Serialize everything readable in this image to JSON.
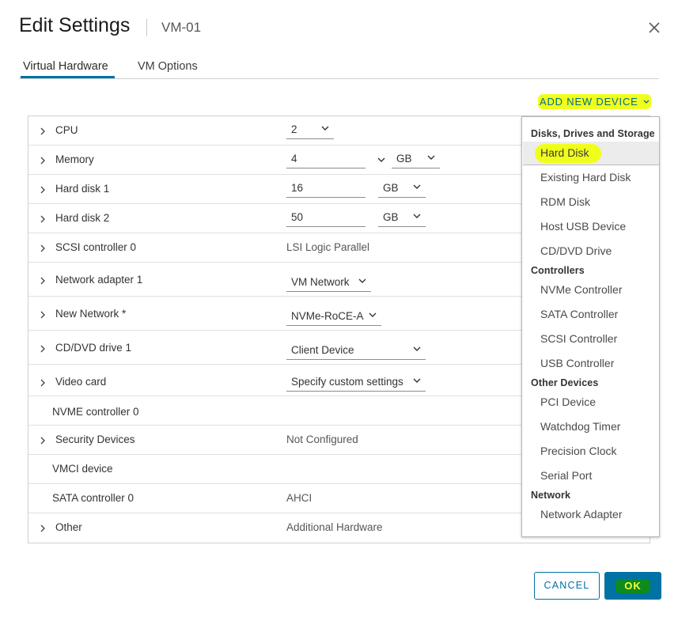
{
  "dialog": {
    "title": "Edit Settings",
    "vm_name": "VM-01"
  },
  "tabs": [
    {
      "label": "Virtual Hardware",
      "active": true
    },
    {
      "label": "VM Options",
      "active": false
    }
  ],
  "add_device_label": "ADD NEW DEVICE",
  "hardware": {
    "cpu": {
      "label": "CPU",
      "value": "2"
    },
    "memory": {
      "label": "Memory",
      "value": "4",
      "unit": "GB"
    },
    "hard_disk_1": {
      "label": "Hard disk 1",
      "value": "16",
      "unit": "GB"
    },
    "hard_disk_2": {
      "label": "Hard disk 2",
      "value": "50",
      "unit": "GB"
    },
    "scsi": {
      "label": "SCSI controller 0",
      "value": "LSI Logic Parallel"
    },
    "net1": {
      "label": "Network adapter 1",
      "value": "VM Network"
    },
    "newnet": {
      "label": "New Network *",
      "value": "NVMe-RoCE-A"
    },
    "cddvd": {
      "label": "CD/DVD drive 1",
      "value": "Client Device"
    },
    "video": {
      "label": "Video card",
      "value": "Specify custom settings"
    },
    "nvme": {
      "label": "NVME controller 0"
    },
    "security": {
      "label": "Security Devices",
      "value": "Not Configured"
    },
    "vmci": {
      "label": "VMCI device"
    },
    "sata": {
      "label": "SATA controller 0",
      "value": "AHCI"
    },
    "other": {
      "label": "Other",
      "value": "Additional Hardware"
    }
  },
  "menu": {
    "groups": {
      "disks": "Disks, Drives and Storage",
      "controllers": "Controllers",
      "other": "Other Devices",
      "network": "Network"
    },
    "items": {
      "hard_disk": "Hard Disk",
      "existing_hard_disk": "Existing Hard Disk",
      "rdm_disk": "RDM Disk",
      "host_usb": "Host USB Device",
      "cd_dvd": "CD/DVD Drive",
      "nvme_ctrl": "NVMe Controller",
      "sata_ctrl": "SATA Controller",
      "scsi_ctrl": "SCSI Controller",
      "usb_ctrl": "USB Controller",
      "pci": "PCI Device",
      "watchdog": "Watchdog Timer",
      "precision_clock": "Precision Clock",
      "serial_port": "Serial Port",
      "network_adapter": "Network Adapter"
    }
  },
  "buttons": {
    "cancel": "CANCEL",
    "ok": "OK"
  },
  "colors": {
    "accent": "#0072a3",
    "highlight": "#f0ff1a",
    "ok_highlight": "#0f8a1d"
  }
}
